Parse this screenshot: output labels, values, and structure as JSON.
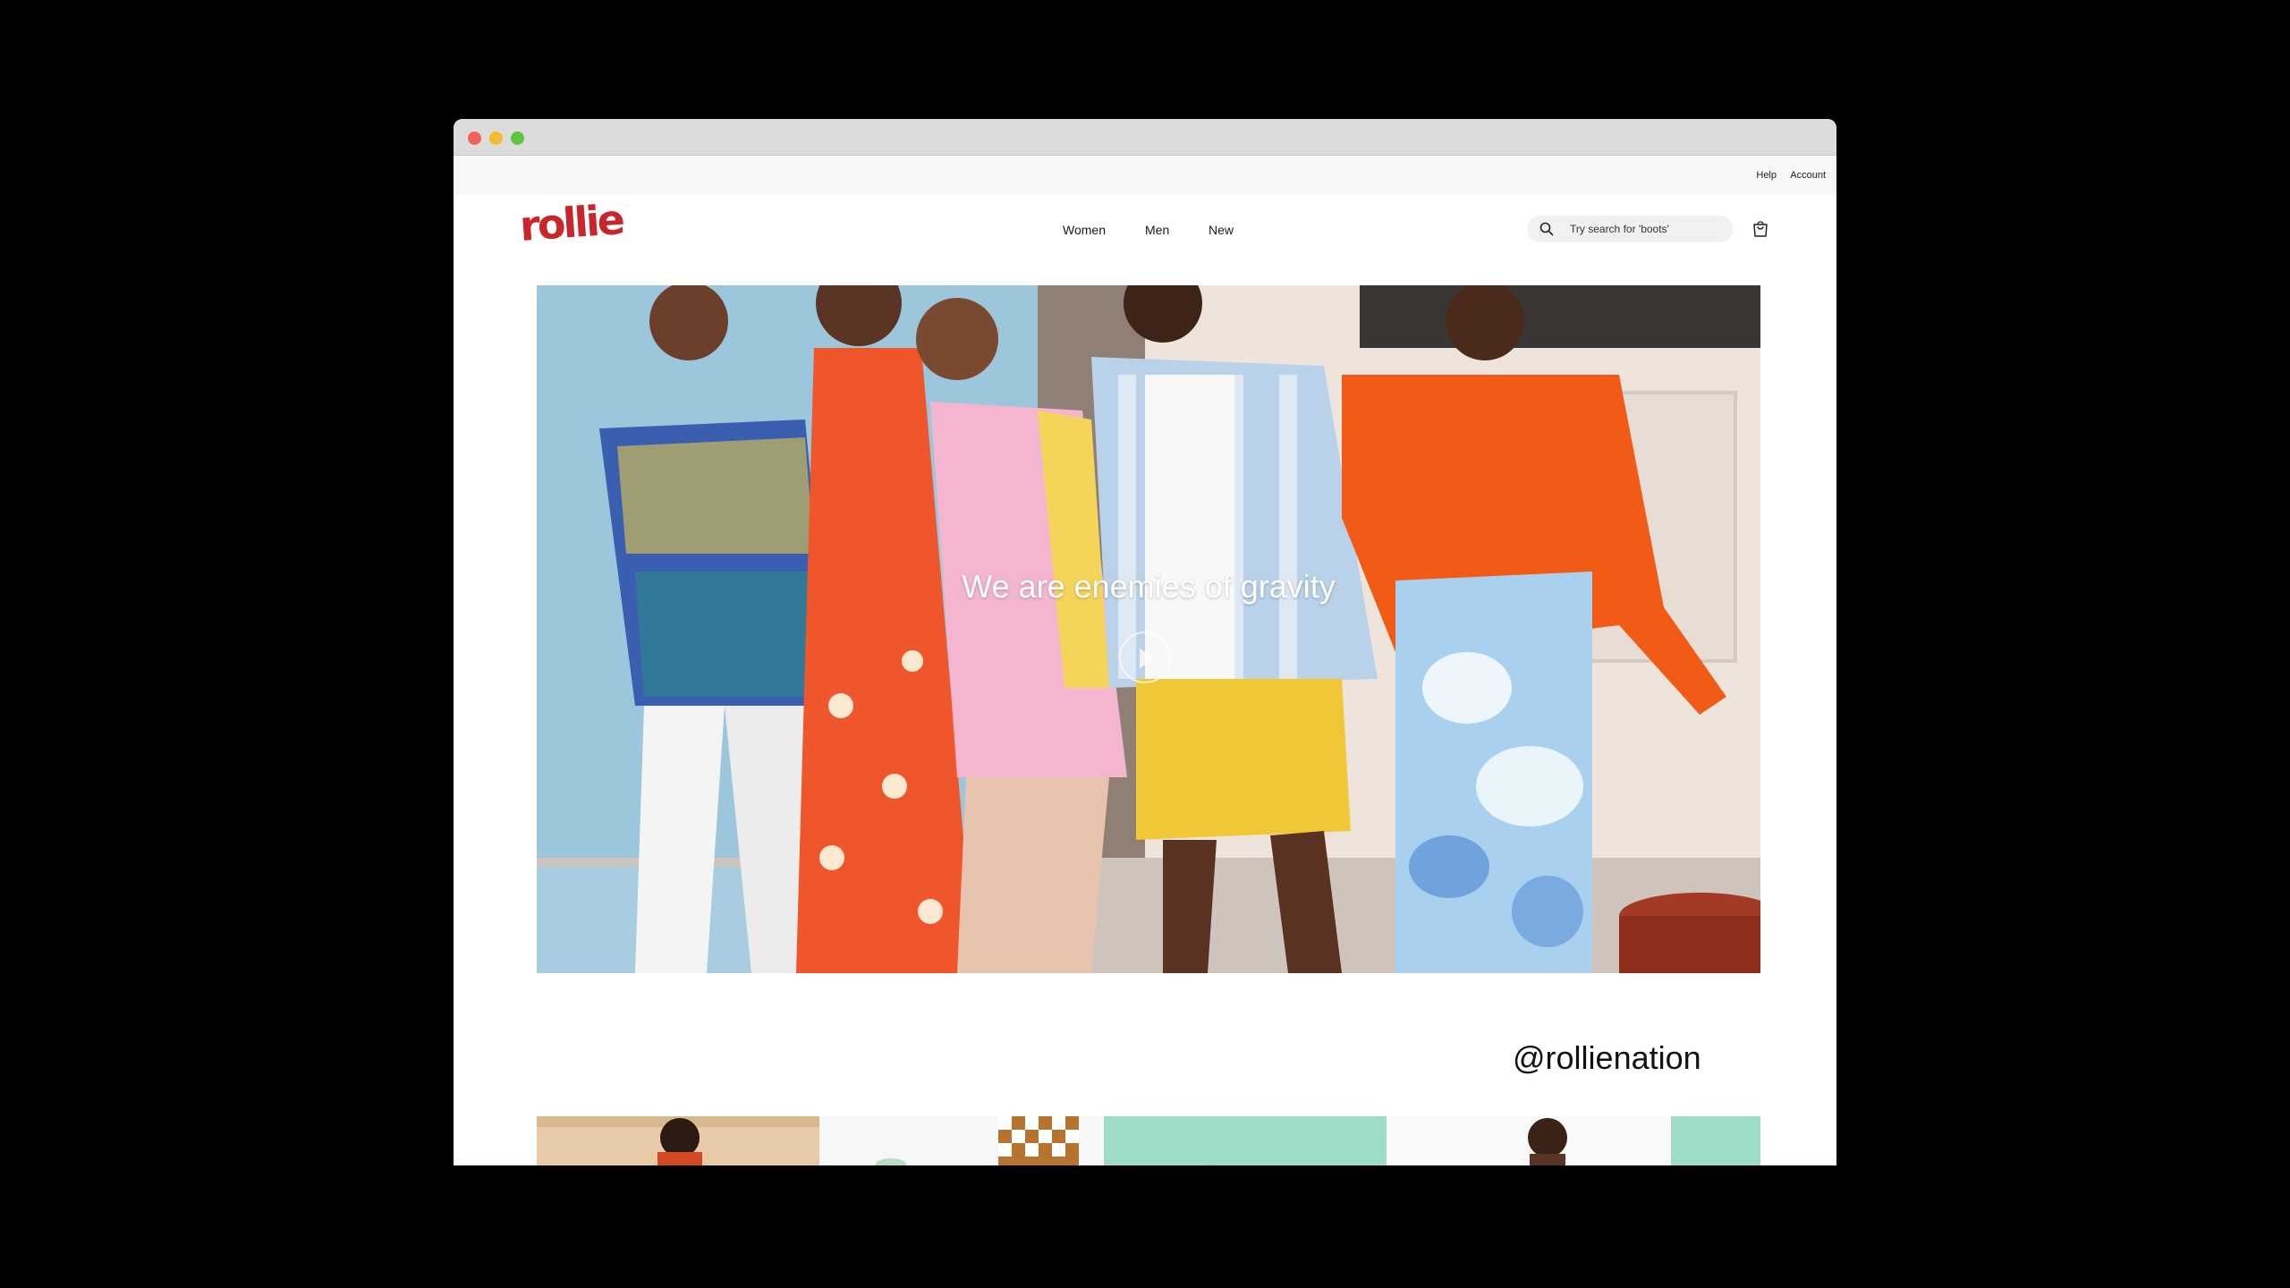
{
  "window": {
    "controls": [
      "close",
      "minimize",
      "zoom"
    ]
  },
  "utility_nav": {
    "help": "Help",
    "account": "Account"
  },
  "header": {
    "logo": "rollie",
    "nav": {
      "women": "Women",
      "men": "Men",
      "new": "New"
    },
    "search": {
      "placeholder": "Try search for 'boots'",
      "icon": "search-icon"
    },
    "cart": {
      "icon": "shopping-bag-icon"
    }
  },
  "hero": {
    "headline": "We are enemies of gravity",
    "play_icon": "play-icon"
  },
  "social": {
    "handle": "@rollienation"
  },
  "colors": {
    "brand": "#c9262c",
    "hero_bg": "#9cc6db",
    "mint": "#9fdcc7"
  }
}
